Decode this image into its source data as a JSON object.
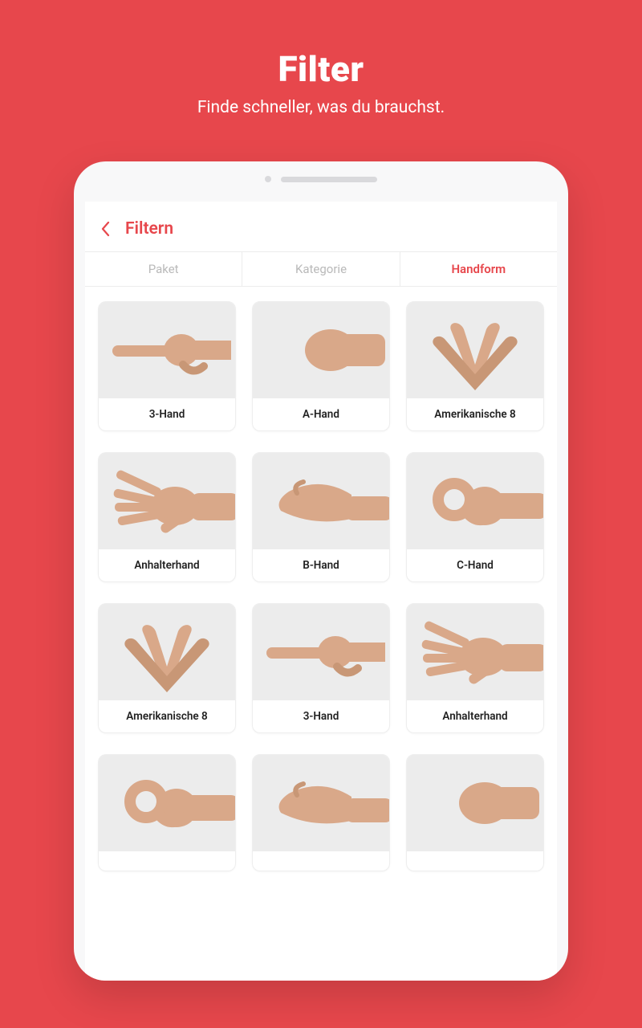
{
  "header": {
    "title": "Filter",
    "subtitle": "Finde schneller, was du brauchst."
  },
  "nav": {
    "title": "Filtern"
  },
  "tabs": [
    {
      "label": "Paket",
      "active": false
    },
    {
      "label": "Kategorie",
      "active": false
    },
    {
      "label": "Handform",
      "active": true
    }
  ],
  "cards": [
    {
      "label": "3-Hand",
      "icon": "pointing"
    },
    {
      "label": "A-Hand",
      "icon": "fist"
    },
    {
      "label": "Amerikanische 8",
      "icon": "twohands"
    },
    {
      "label": "Anhalterhand",
      "icon": "spread"
    },
    {
      "label": "B-Hand",
      "icon": "flat"
    },
    {
      "label": "C-Hand",
      "icon": "pinch"
    },
    {
      "label": "Amerikanische 8",
      "icon": "twohands"
    },
    {
      "label": "3-Hand",
      "icon": "pointing"
    },
    {
      "label": "Anhalterhand",
      "icon": "spread"
    },
    {
      "label": "",
      "icon": "pinch"
    },
    {
      "label": "",
      "icon": "flat"
    },
    {
      "label": "",
      "icon": "fist"
    }
  ]
}
